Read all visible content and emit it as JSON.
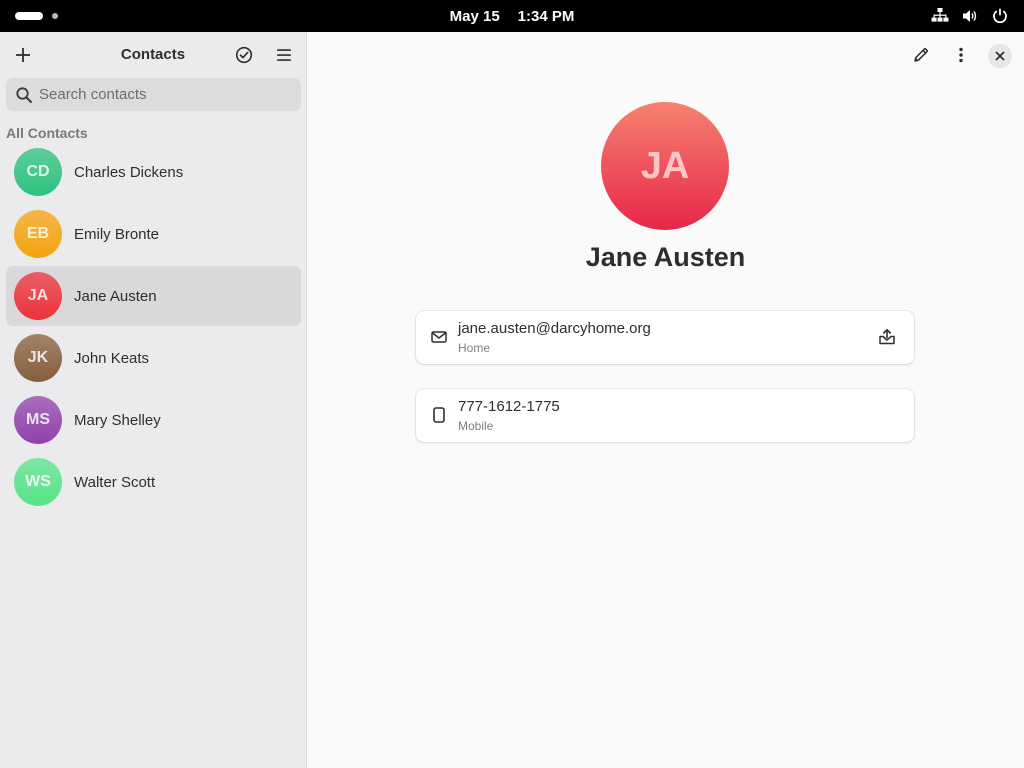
{
  "topbar": {
    "date": "May 15",
    "time": "1:34 PM",
    "icons": [
      "network-icon",
      "volume-icon",
      "power-icon"
    ]
  },
  "sidebar": {
    "title": "Contacts",
    "search_placeholder": "Search contacts",
    "section_label": "All Contacts",
    "contacts": [
      {
        "initials": "CD",
        "name": "Charles Dickens",
        "color": "#2ec27e",
        "selected": false
      },
      {
        "initials": "EB",
        "name": "Emily Bronte",
        "color": "#f5a30e",
        "selected": false
      },
      {
        "initials": "JA",
        "name": "Jane Austen",
        "color": "#ed333b",
        "selected": true
      },
      {
        "initials": "JK",
        "name": "John Keats",
        "color": "#865e3c",
        "selected": false
      },
      {
        "initials": "MS",
        "name": "Mary Shelley",
        "color": "#9141ac",
        "selected": false
      },
      {
        "initials": "WS",
        "name": "Walter Scott",
        "color": "#57e389",
        "selected": false
      }
    ]
  },
  "detail": {
    "initials": "JA",
    "name": "Jane Austen",
    "email": {
      "value": "jane.austen@darcyhome.org",
      "label": "Home"
    },
    "phone": {
      "value": "777-1612-1775",
      "label": "Mobile"
    }
  },
  "colors": {
    "accent_avatar_top": "#f6826f",
    "accent_avatar_bottom": "#e8264a",
    "sidebar_bg": "#ebebed",
    "selected_row": "#d9d9db"
  }
}
